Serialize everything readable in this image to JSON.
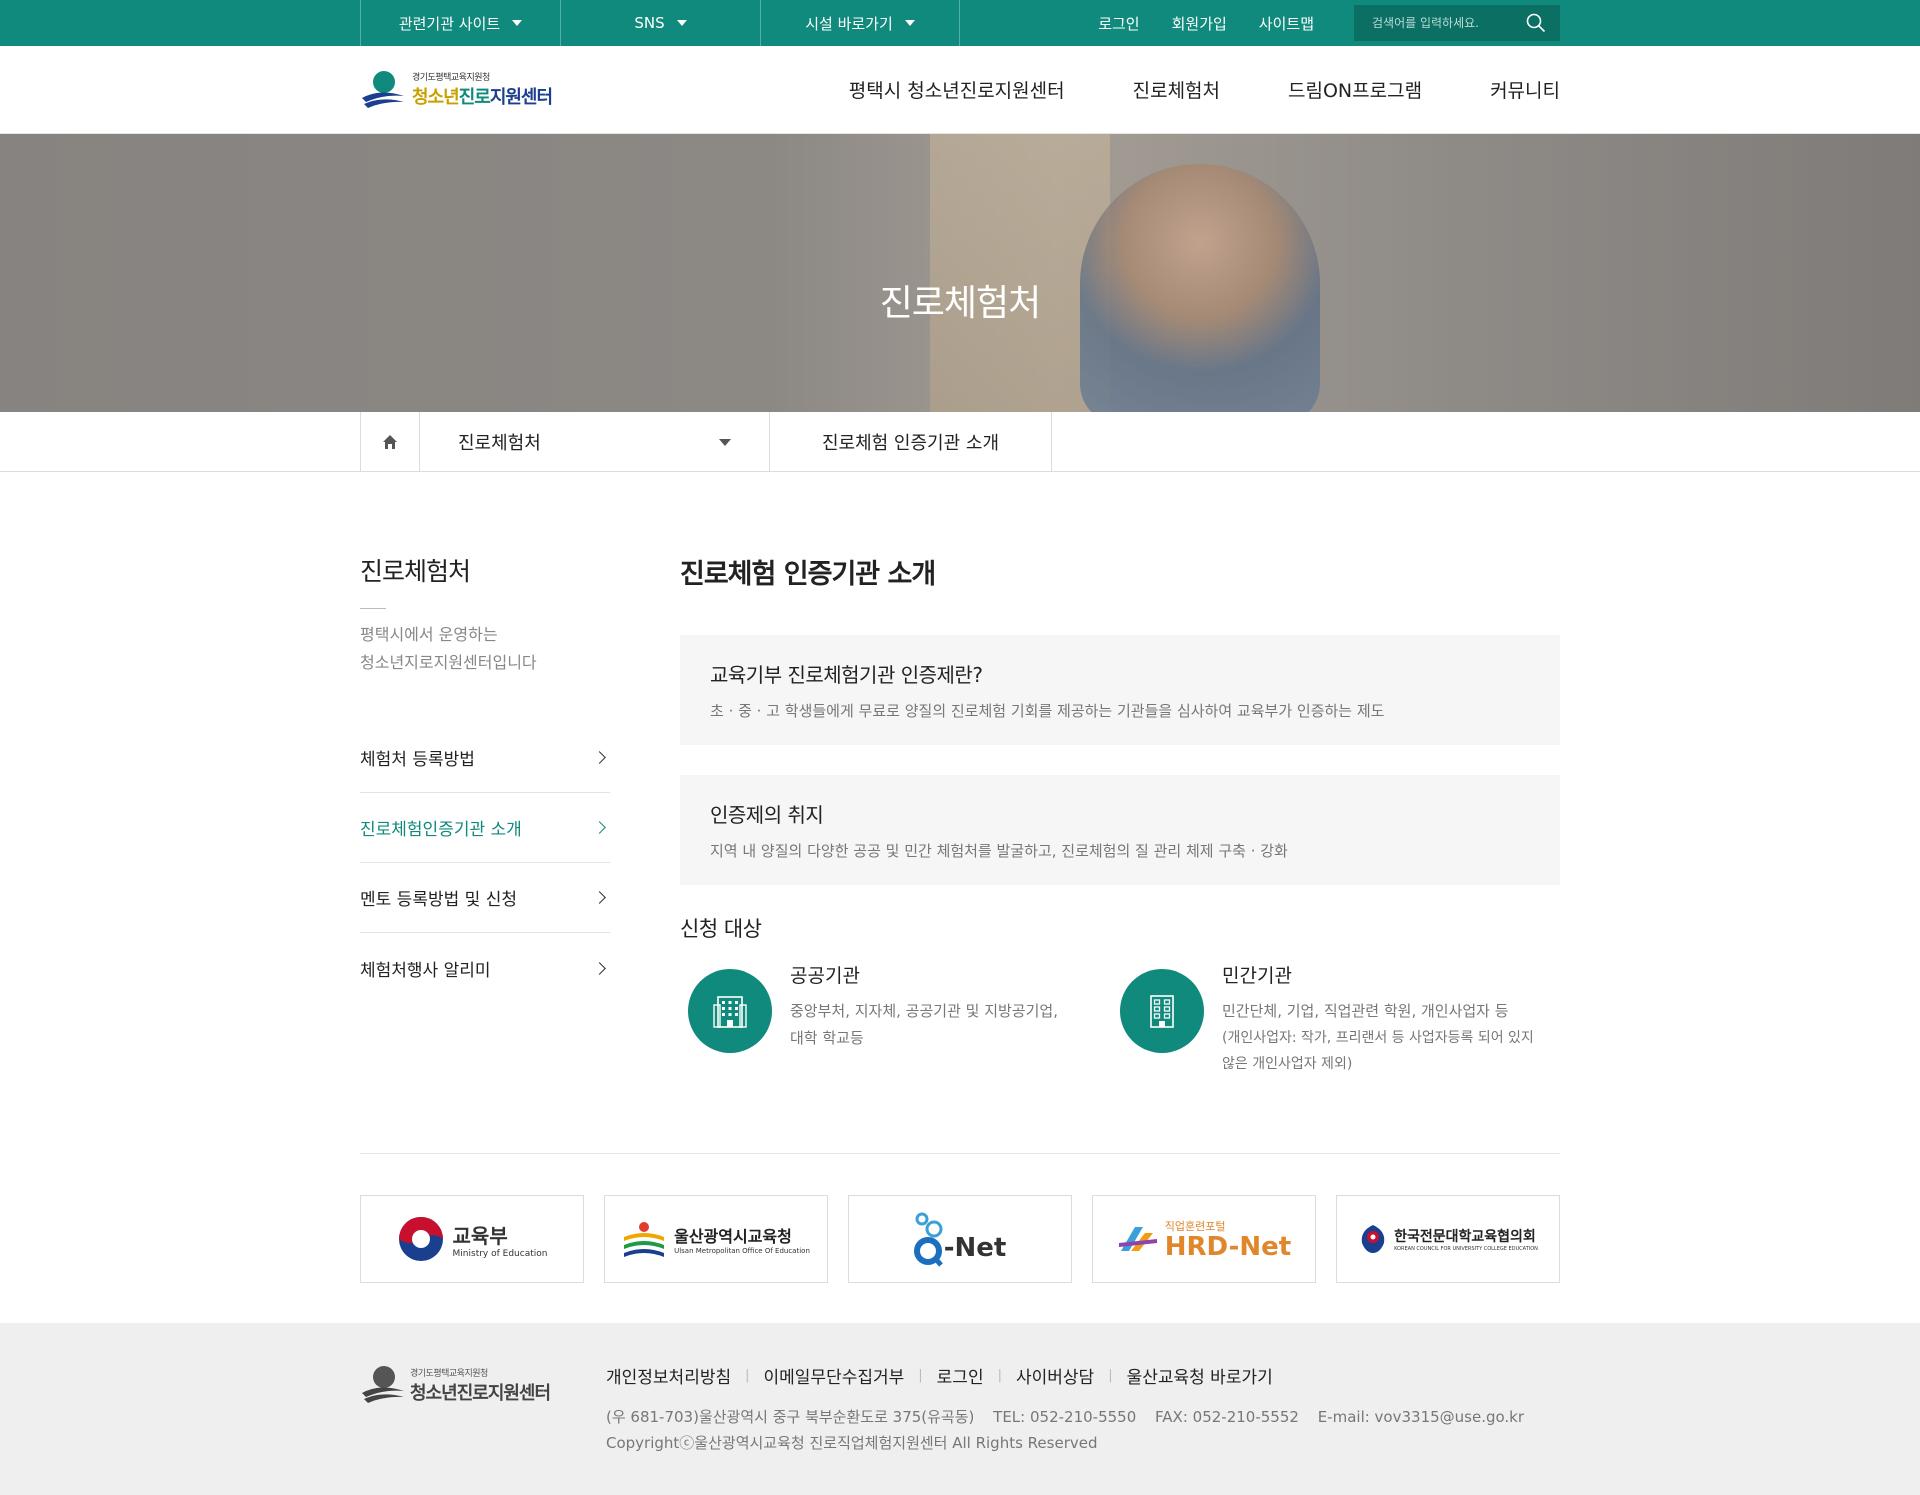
{
  "topbar": {
    "drops": [
      "관련기관 사이트",
      "SNS",
      "시설 바로가기"
    ],
    "links": [
      "로그인",
      "회원가입",
      "사이트맵"
    ],
    "search_placeholder": "검색어를 입력하세요."
  },
  "logo": {
    "small": "경기도평택교육지원청",
    "large_a": "청소년",
    "large_b": "진로",
    "large_c": "지원센터"
  },
  "gnb": [
    "평택시 청소년진로지원센터",
    "진로체험처",
    "드림ON프로그램",
    "커뮤니티"
  ],
  "hero": {
    "title": "진로체험처"
  },
  "location": {
    "drop": "진로체험처",
    "current": "진로체험 인증기관 소개"
  },
  "lnb": {
    "title": "진로체험처",
    "desc1": "평택시에서 운영하는",
    "desc2": "청소년지로지원센터입니다",
    "items": [
      "체험처 등록방법",
      "진로체험인증기관 소개",
      "멘토 등록방법 및 신청",
      "체험처행사 알리미"
    ]
  },
  "main": {
    "title": "진로체험 인증기관 소개",
    "box1": {
      "title": "교육기부 진로체험기관 인증제란?",
      "text": "초 · 중 · 고 학생들에게 무료로 양질의 진로체험 기회를 제공하는 기관들을 심사하여 교육부가 인증하는 제도"
    },
    "box2": {
      "title": "인증제의 취지",
      "text": "지역 내 양질의 다양한 공공 및 민간 체험처를 발굴하고, 진로체험의 질 관리 체제 구축 · 강화"
    },
    "sub_title": "신청 대상",
    "targets": [
      {
        "title": "공공기관",
        "desc1": "중앙부처, 지자체, 공공기관 및 지방공기업,",
        "desc2": "대학 학교등",
        "note1": "",
        "note2": ""
      },
      {
        "title": "민간기관",
        "desc1": "민간단체, 기업, 직업관련 학원, 개인사업자 등",
        "desc2": "",
        "note1": "(개인사업자: 작가, 프리랜서 등 사업자등록 되어 있지",
        "note2": "않은 개인사업자 제외)"
      }
    ]
  },
  "partners": {
    "moe": {
      "ko": "교육부",
      "en": "Ministry of Education"
    },
    "ulsan": {
      "ko": "울산광역시교육청",
      "en": "Ulsan Metropolitan Office Of Education"
    },
    "qnet": {
      "q": "Q",
      "net": "-Net"
    },
    "hrd": {
      "small": "직업훈련포털",
      "big": "HRD-Net"
    },
    "kcuce": {
      "ko": "한국전문대학교육협의회",
      "en": "KOREAN COUNCIL FOR UNIVERSITY COLLEGE EDUCATION"
    }
  },
  "footer": {
    "links": [
      "개인정보처리방침",
      "이메일무단수집거부",
      "로그인",
      "사이버상담",
      "울산교육청 바로가기"
    ],
    "address": "(우 681-703)울산광역시 중구 북부순환도로 375(유곡동)",
    "tel": "TEL: 052-210-5550",
    "fax": "FAX: 052-210-5552",
    "email": "E-mail: vov3315@use.go.kr",
    "copyright": "Copyrightⓒ울산광역시교육청 진로직업체험지원센터 All Rights Reserved"
  },
  "colors": {
    "brand": "#0f8a7c",
    "brand_dark": "#0b6f64",
    "text": "#222222",
    "muted": "#777777"
  }
}
